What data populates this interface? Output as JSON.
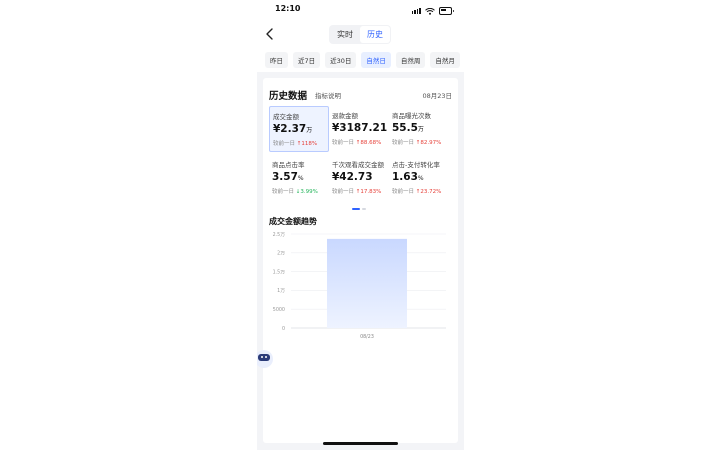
{
  "status": {
    "time": "12:10"
  },
  "tabs": [
    {
      "label": "实时",
      "active": false
    },
    {
      "label": "历史",
      "active": true
    }
  ],
  "date_ranges": [
    {
      "label": "昨日",
      "active": false
    },
    {
      "label": "近7日",
      "active": false
    },
    {
      "label": "近30日",
      "active": false
    },
    {
      "label": "自然日",
      "active": true
    },
    {
      "label": "自然周",
      "active": false
    },
    {
      "label": "自然月",
      "active": false
    }
  ],
  "card": {
    "title": "历史数据",
    "link": "指标说明",
    "date": "08月23日"
  },
  "metrics": [
    {
      "label": "成交金额",
      "value": "¥2.37",
      "unit": "万",
      "compare": "较前一日",
      "change": "↑118%",
      "trend": "up",
      "selected": true
    },
    {
      "label": "退款金额",
      "value": "¥3187.21",
      "unit": "",
      "compare": "较前一日",
      "change": "↑88.68%",
      "trend": "up",
      "selected": false
    },
    {
      "label": "商品曝光次数",
      "value": "55.5",
      "unit": "万",
      "compare": "较前一日",
      "change": "↑82.97%",
      "trend": "up",
      "selected": false
    },
    {
      "label": "商品点击率",
      "value": "3.57",
      "unit": "%",
      "compare": "较前一日",
      "change": "↓3.99%",
      "trend": "down",
      "selected": false
    },
    {
      "label": "千次观看成交金额",
      "value": "¥42.73",
      "unit": "",
      "compare": "较前一日",
      "change": "↑17.83%",
      "trend": "up",
      "selected": false
    },
    {
      "label": "点击-支付转化率",
      "value": "1.63",
      "unit": "%",
      "compare": "较前一日",
      "change": "↑23.72%",
      "trend": "up",
      "selected": false
    }
  ],
  "colors": {
    "accent": "#2f62ff",
    "up": "#e6413a",
    "down": "#23b45a"
  },
  "chart_title": "成交金额趋势",
  "chart_data": {
    "type": "bar",
    "categories": [
      "08/23"
    ],
    "values": [
      23700
    ],
    "ylim": [
      0,
      25000
    ],
    "yticks": [
      0,
      5000,
      10000,
      15000,
      20000,
      25000
    ],
    "ytick_labels": [
      "0",
      "5000",
      "1万",
      "1.5万",
      "2万",
      "2.5万"
    ],
    "grid": true
  },
  "icons": {
    "back": "chevron-left-icon",
    "assistant": "robot-assistant-icon"
  }
}
